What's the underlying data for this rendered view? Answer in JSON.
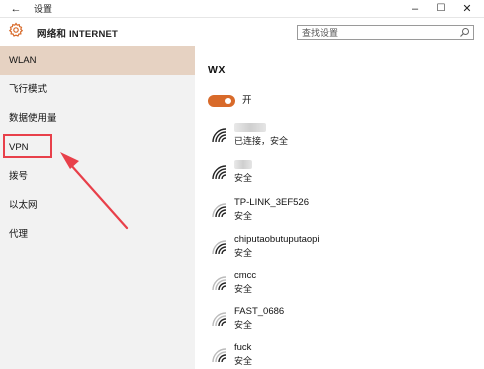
{
  "window": {
    "title": "设置"
  },
  "header": {
    "section_title": "网络和 INTERNET"
  },
  "search": {
    "placeholder": "查找设置"
  },
  "sidebar": {
    "items": [
      {
        "label": "WLAN",
        "active": true
      },
      {
        "label": "飞行模式"
      },
      {
        "label": "数据使用量"
      },
      {
        "label": "VPN"
      },
      {
        "label": "拨号"
      },
      {
        "label": "以太网"
      },
      {
        "label": "代理"
      }
    ]
  },
  "main": {
    "title": "WX",
    "toggle": {
      "label": "开",
      "on": true
    },
    "networks": [
      {
        "name": "",
        "status": "已连接，安全"
      },
      {
        "name": "",
        "status": "安全"
      },
      {
        "name": "TP-LINK_3EF526",
        "status": "安全"
      },
      {
        "name": "chiputaobutuputaopi",
        "status": "安全"
      },
      {
        "name": "cmcc",
        "status": "安全"
      },
      {
        "name": "FAST_0686",
        "status": "安全"
      },
      {
        "name": "fuck",
        "status": "安全"
      }
    ]
  },
  "colors": {
    "accent": "#d86a2a",
    "active_nav": "#e6d2c2",
    "annotation": "#e8404a"
  },
  "icons": {
    "back": "back-arrow-icon",
    "settings": "gear-icon",
    "search": "search-icon",
    "wifi": "wifi-icon"
  }
}
